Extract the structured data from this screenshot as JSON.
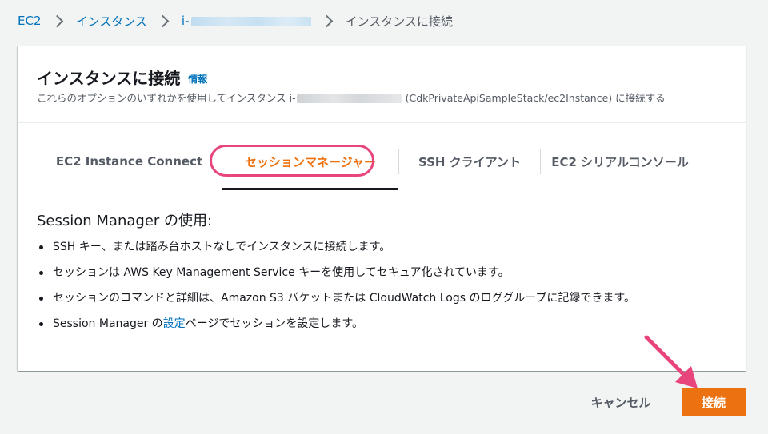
{
  "breadcrumb": {
    "items": [
      "EC2",
      "インスタンス",
      "i-"
    ],
    "current": "インスタンスに接続"
  },
  "header": {
    "title": "インスタンスに接続",
    "info_link": "情報",
    "description_prefix": "これらのオプションのいずれかを使用してインスタンス i-",
    "description_suffix": "(CdkPrivateApiSampleStack/ec2Instance) に接続する"
  },
  "tabs": [
    {
      "label": "EC2 Instance Connect",
      "active": false
    },
    {
      "label": "セッションマネージャー",
      "active": true
    },
    {
      "label": "SSH クライアント",
      "active": false
    },
    {
      "label": "EC2 シリアルコンソール",
      "active": false
    }
  ],
  "content": {
    "heading": "Session Manager の使用:",
    "bullets": [
      "SSH キー、または踏み台ホストなしでインスタンスに接続します。",
      "セッションは AWS Key Management Service キーを使用してセキュア化されています。",
      "セッションのコマンドと詳細は、Amazon S3 バケットまたは CloudWatch Logs のロググループに記録できます。"
    ],
    "last_bullet": {
      "prefix": "Session Manager の",
      "link": "設定",
      "suffix": "ページでセッションを設定します。"
    }
  },
  "footer": {
    "cancel_label": "キャンセル",
    "connect_label": "接続"
  },
  "colors": {
    "accent_orange": "#ec7211",
    "link_blue": "#0073bb",
    "annotation_pink": "#e8457d",
    "background": "#f2f3f3"
  },
  "icons": {
    "breadcrumb_separator": "chevron-right-icon",
    "annotation": "arrow-icon"
  }
}
